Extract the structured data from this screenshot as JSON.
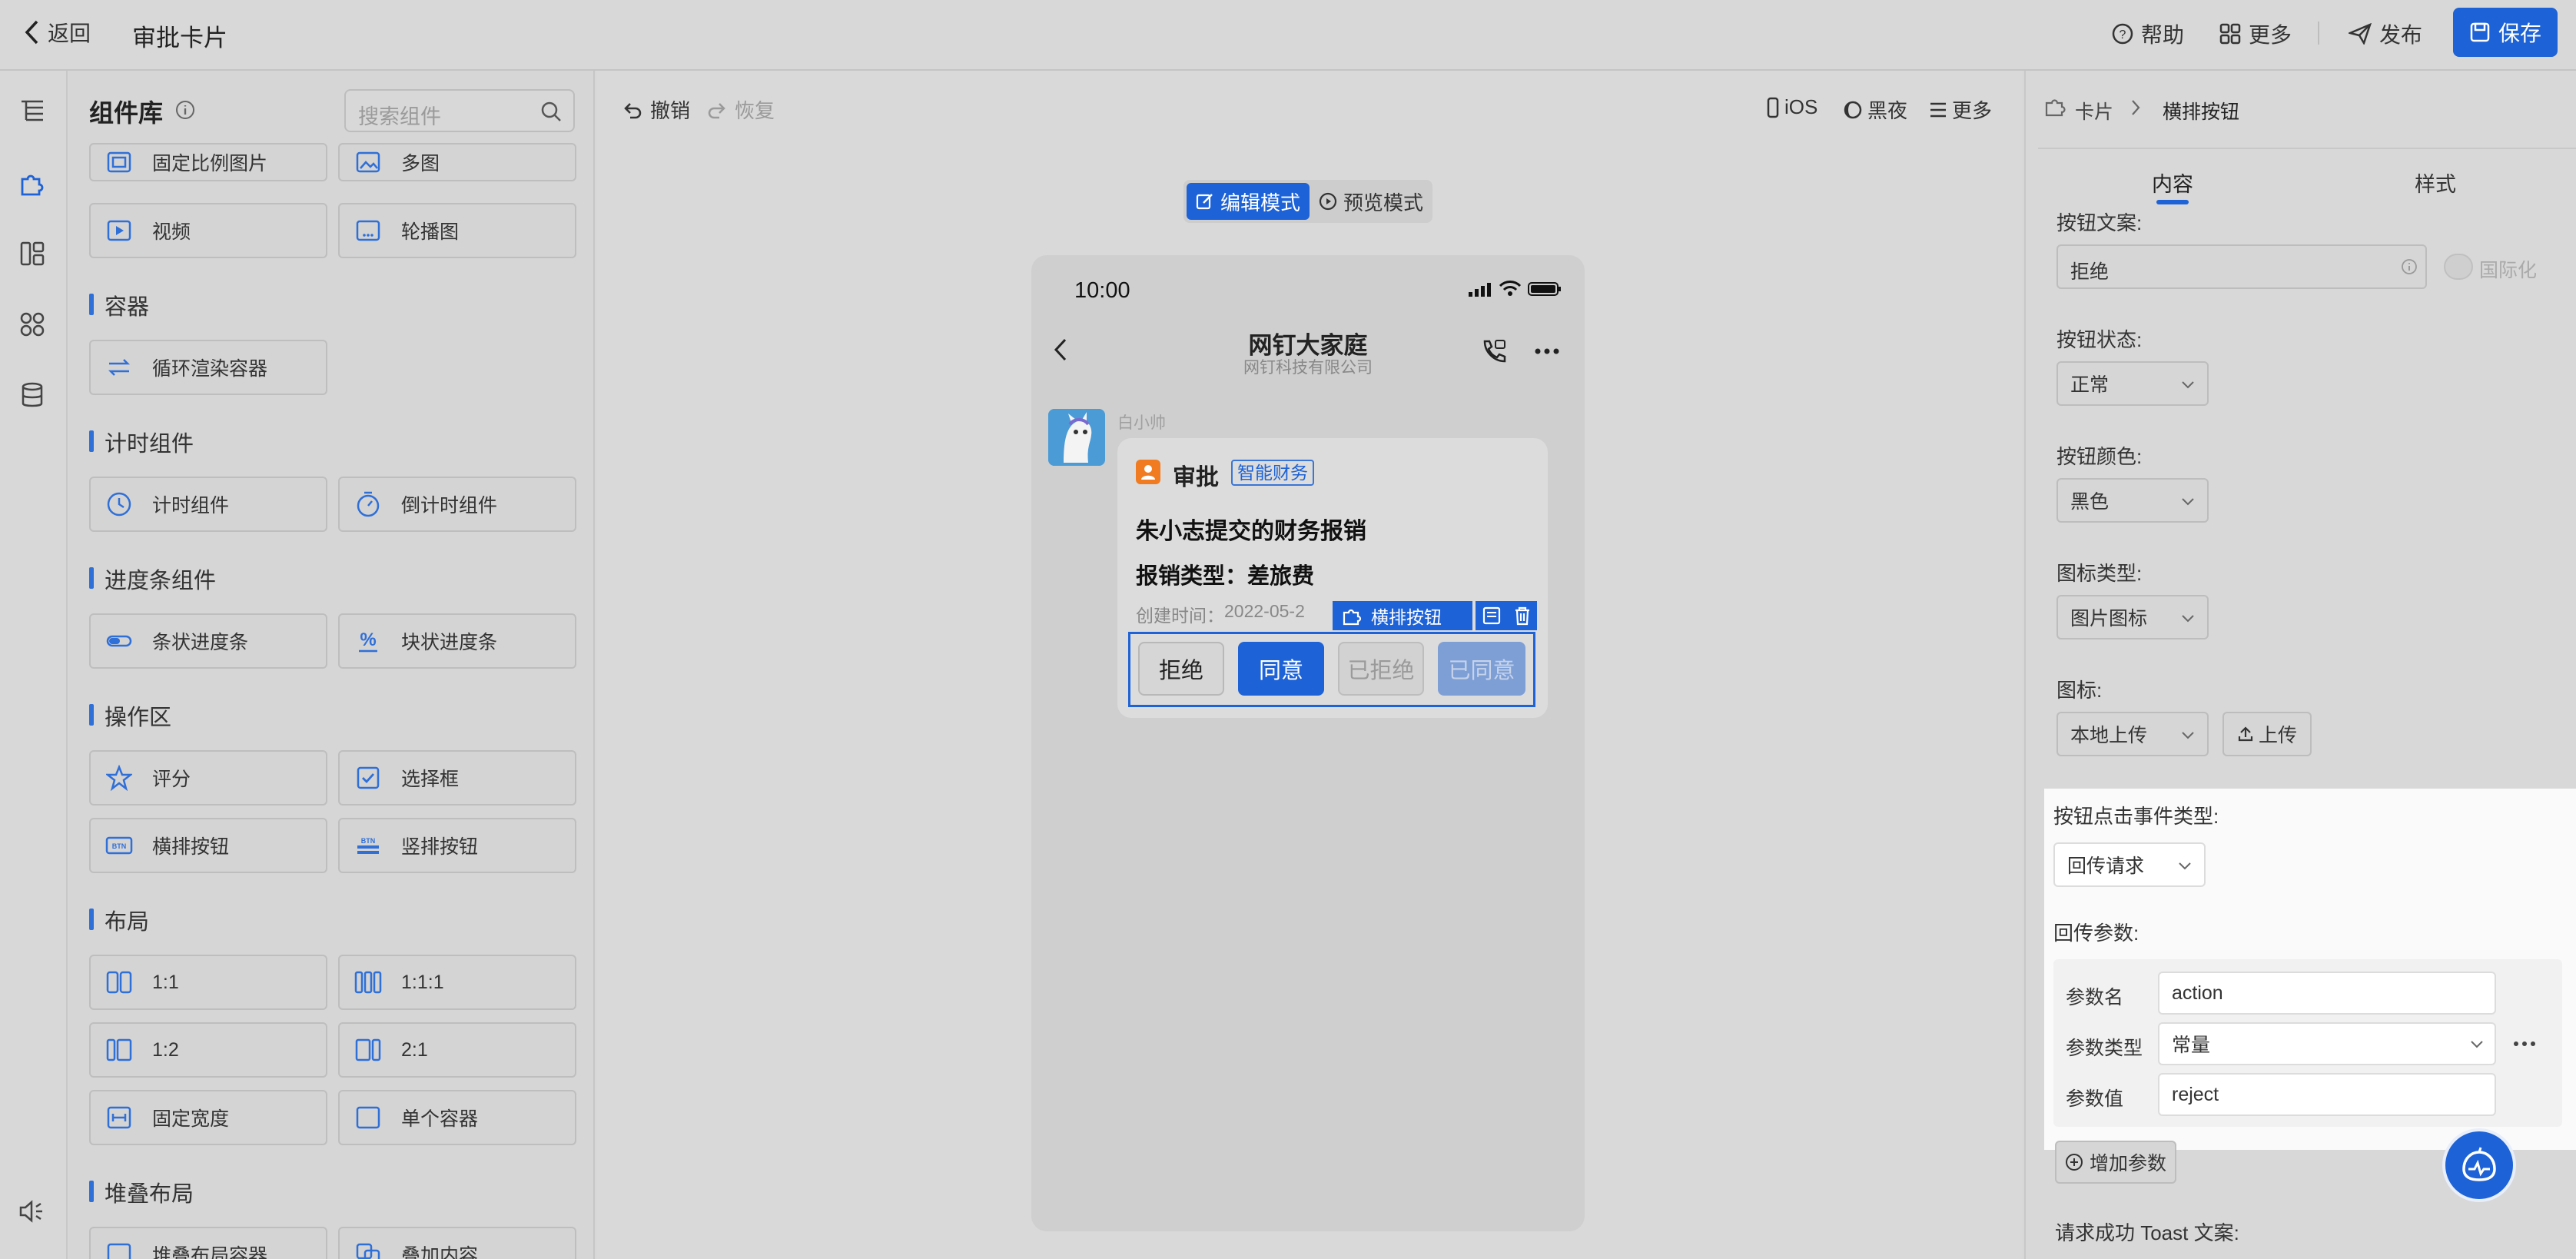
{
  "header": {
    "back_label": "返回",
    "title": "审批卡片",
    "help_label": "帮助",
    "more_label": "更多",
    "publish_label": "发布",
    "save_label": "保存"
  },
  "library": {
    "title": "组件库",
    "search_placeholder": "搜索组件",
    "items_top": [
      "固定比例图片",
      "多图",
      "视频",
      "轮播图"
    ],
    "sections": [
      {
        "title": "容器",
        "items": [
          "循环渲染容器"
        ]
      },
      {
        "title": "计时组件",
        "items": [
          "计时组件",
          "倒计时组件"
        ]
      },
      {
        "title": "进度条组件",
        "items": [
          "条状进度条",
          "块状进度条"
        ]
      },
      {
        "title": "操作区",
        "items": [
          "评分",
          "选择框",
          "横排按钮",
          "竖排按钮"
        ]
      },
      {
        "title": "布局",
        "items": [
          "1:1",
          "1:1:1",
          "1:2",
          "2:1",
          "固定宽度",
          "单个容器"
        ]
      },
      {
        "title": "堆叠布局",
        "items": [
          "堆叠布局容器",
          "叠加内容"
        ]
      }
    ]
  },
  "toolbar": {
    "undo_label": "撤销",
    "redo_label": "恢复",
    "ios_label": "iOS",
    "dark_label": "黑夜",
    "more_label": "更多"
  },
  "mode": {
    "edit_label": "编辑模式",
    "preview_label": "预览模式"
  },
  "phone": {
    "time": "10:00",
    "chat_title": "网钉大家庭",
    "chat_subtitle": "网钉科技有限公司",
    "sender": "白小帅",
    "card": {
      "app_name": "审批",
      "tag": "智能财务",
      "title": "朱小志提交的财务报销",
      "type_label": "报销类型：",
      "type_value": "差旅费",
      "created_label": "创建时间：",
      "created_value": "2022-05-2",
      "selection_label": "横排按钮",
      "buttons": [
        "拒绝",
        "同意",
        "已拒绝",
        "已同意"
      ]
    }
  },
  "panel": {
    "breadcrumb_root": "卡片",
    "breadcrumb_leaf": "横排按钮",
    "tab_content": "内容",
    "tab_style": "样式",
    "button_text_label": "按钮文案:",
    "button_text_value": "拒绝",
    "i18n_label": "国际化",
    "state_label": "按钮状态:",
    "state_value": "正常",
    "color_label": "按钮颜色:",
    "color_value": "黑色",
    "icon_type_label": "图标类型:",
    "icon_type_value": "图片图标",
    "icon_label": "图标:",
    "icon_source_value": "本地上传",
    "upload_label": "上传",
    "event_type_label": "按钮点击事件类型:",
    "event_type_value": "回传请求",
    "params_label": "回传参数:",
    "param_name_label": "参数名",
    "param_name_value": "action",
    "param_type_label": "参数类型",
    "param_type_value": "常量",
    "param_value_label": "参数值",
    "param_value_value": "reject",
    "add_param_label": "增加参数",
    "toast_label": "请求成功 Toast 文案:"
  },
  "colors": {
    "accent": "#1d62d6",
    "header_bg": "#d8d8d8",
    "highlight_bg": "#fafafa"
  }
}
